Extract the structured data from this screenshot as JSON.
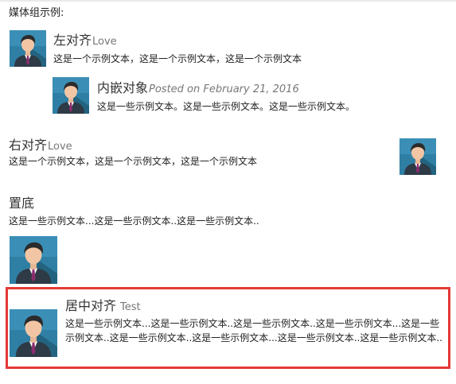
{
  "intro": "媒体组示例:",
  "avatar_icon": "user-avatar-icon",
  "colors": {
    "avatar_bg": "#2f7fa4",
    "highlight_border": "#e53935",
    "muted": "#777777"
  },
  "media": {
    "left": {
      "heading": "左对齐",
      "small": "Love",
      "text": "这是一个示例文本，这是一个示例文本，这是一个示例文本"
    },
    "nested": {
      "heading": "内嵌对象",
      "small": "Posted on February 21, 2016",
      "text": "这是一些示例文本。这是一些示例文本。这是一些示例文本。"
    },
    "right": {
      "heading": "右对齐",
      "small": "Love",
      "text": "这是一个示例文本，这是一个示例文本，这是一个示例文本"
    },
    "bottom": {
      "heading": "置底",
      "text": "这是一些示例文本...这是一些示例文本..这是一些示例文本.."
    },
    "middle": {
      "heading": "居中对齐",
      "small": "Test",
      "text": "这是一些示例文本...这是一些示例文本..这是一些示例文本..这是一些示例文本...这是一些示例文本..这是一些示例文本..这是一些示例文本...这是一些示例文本..这是一些示例文本.."
    }
  }
}
